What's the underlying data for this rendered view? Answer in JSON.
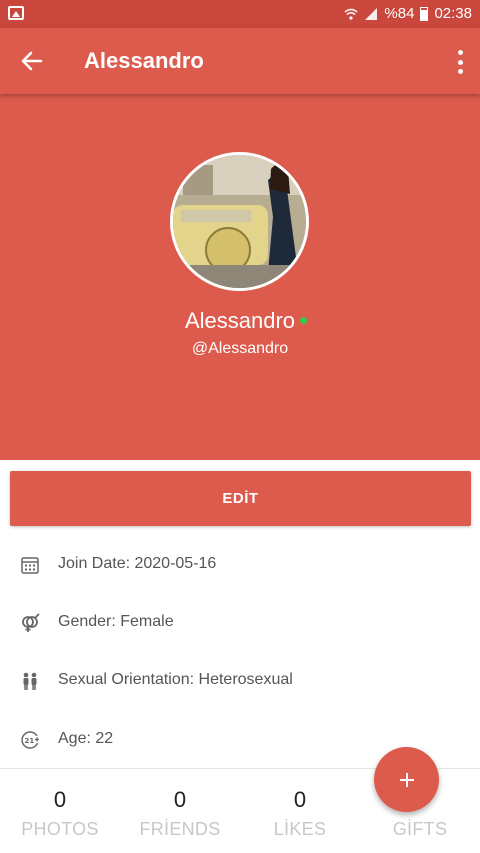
{
  "status_bar": {
    "battery": "%84",
    "time": "02:38"
  },
  "app_bar": {
    "title": "Alessandro"
  },
  "profile": {
    "name": "Alessandro",
    "handle": "@Alessandro",
    "online": true
  },
  "edit_button": {
    "label": "EDİT"
  },
  "info": [
    {
      "icon": "calendar-icon",
      "text": "Join Date: 2020-05-16"
    },
    {
      "icon": "gender-icon",
      "text": "Gender: Female"
    },
    {
      "icon": "people-icon",
      "text": "Sexual Orientation: Heterosexual"
    },
    {
      "icon": "age-21-icon",
      "text": "Age: 22"
    }
  ],
  "stats": [
    {
      "value": "0",
      "label": "PHOTOS"
    },
    {
      "value": "0",
      "label": "FRİENDS"
    },
    {
      "value": "0",
      "label": "LİKES"
    },
    {
      "value": "",
      "label": "GİFTS"
    }
  ],
  "colors": {
    "primary": "#dd5b4c",
    "status_bar": "#c9473d",
    "online": "#2fcc4a"
  }
}
